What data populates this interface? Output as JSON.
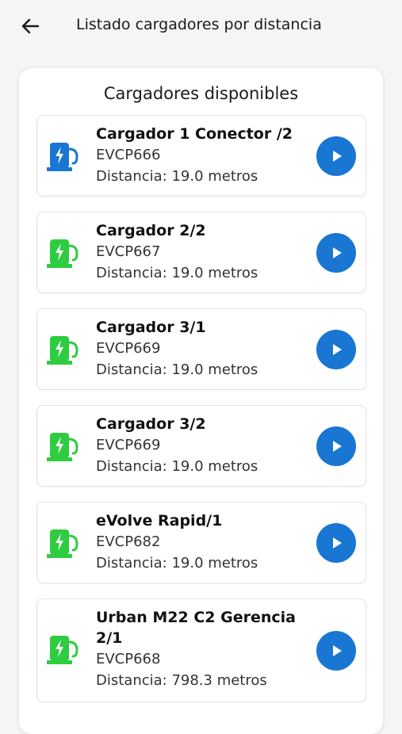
{
  "header": {
    "title": "Listado cargadores por distancia"
  },
  "panel": {
    "title": "Cargadores disponibles"
  },
  "chargers": [
    {
      "name": "Cargador 1 Conector /2",
      "code": "EVCP666",
      "distance": "Distancia: 19.0 metros",
      "status_color": "#1976d2"
    },
    {
      "name": "Cargador 2/2",
      "code": "EVCP667",
      "distance": "Distancia: 19.0 metros",
      "status_color": "#2ecc40"
    },
    {
      "name": "Cargador 3/1",
      "code": "EVCP669",
      "distance": "Distancia: 19.0 metros",
      "status_color": "#2ecc40"
    },
    {
      "name": "Cargador 3/2",
      "code": "EVCP669",
      "distance": "Distancia: 19.0 metros",
      "status_color": "#2ecc40"
    },
    {
      "name": "eVolve Rapid/1",
      "code": "EVCP682",
      "distance": "Distancia: 19.0 metros",
      "status_color": "#2ecc40"
    },
    {
      "name": "Urban M22 C2 Gerencia 2/1",
      "code": "EVCP668",
      "distance": "Distancia: 798.3 metros",
      "status_color": "#2ecc40"
    }
  ],
  "colors": {
    "accent": "#1976d2",
    "available": "#2ecc40"
  },
  "icons": {
    "back": "arrow-left-icon",
    "charger": "ev-charger-icon",
    "play": "play-icon"
  }
}
